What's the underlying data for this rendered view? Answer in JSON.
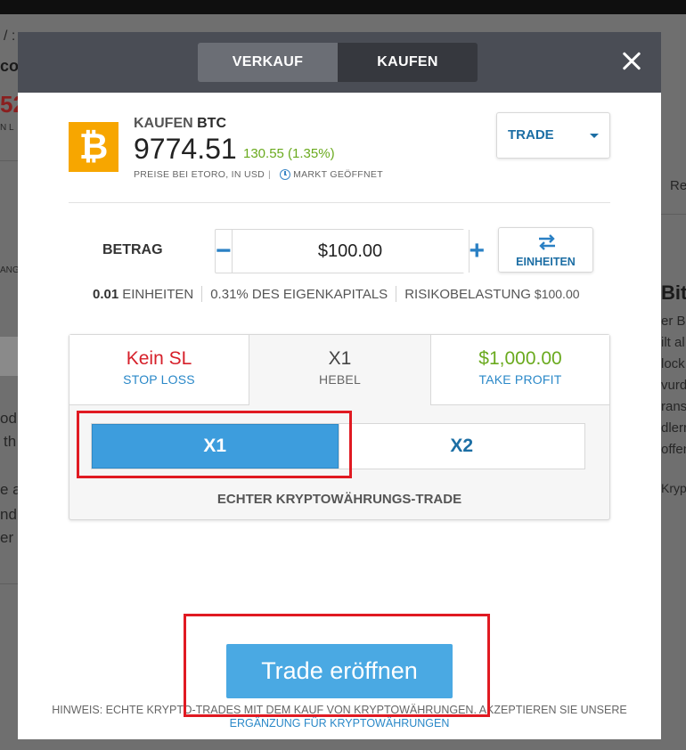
{
  "background": {
    "breadcrumb": "/ :",
    "fragments": [
      "coi",
      "52",
      "N L",
      "Re",
      "ANG",
      "Bitc",
      "er B",
      "ilt al",
      "lock",
      "vurd",
      "rans",
      "dlerr",
      "offen",
      "Kryp",
      "od",
      "th",
      "e a",
      "ndi",
      "er t"
    ]
  },
  "modal": {
    "tabs": {
      "sell": "VERKAUF",
      "buy": "KAUFEN"
    },
    "instrument": {
      "action": "KAUFEN",
      "symbol": "BTC",
      "logo_glyph": "₿",
      "price": "9774.51",
      "change": "130.55 (1.35%)",
      "price_note": "PREISE BEI ETORO, IN USD",
      "market_status": "MARKT GEÖFFNET"
    },
    "order_type": "TRADE",
    "amount": {
      "label": "BETRAG",
      "value": "$100.00",
      "minus": "−",
      "plus": "+",
      "units_button": "EINHEITEN"
    },
    "info": {
      "units_value": "0.01",
      "units_label": "EINHEITEN",
      "equity": "0.31% DES EIGENKAPITALS",
      "risk_label": "RISIKOBELASTUNG",
      "risk_value": "$100.00"
    },
    "panel": {
      "stop_loss": {
        "value": "Kein SL",
        "label": "STOP LOSS"
      },
      "leverage": {
        "value": "X1",
        "label": "HEBEL"
      },
      "take_profit": {
        "value": "$1,000.00",
        "label": "TAKE PROFIT"
      },
      "options": [
        "X1",
        "X2"
      ],
      "selected": "X1",
      "note": "ECHTER KRYPTOWÄHRUNGS-TRADE"
    },
    "open_trade_button": "Trade eröffnen",
    "footer": {
      "notice": "HINWEIS: ECHTE KRYPTO-TRADES MIT DEM KAUF VON KRYPTOWÄHRUNGEN. AKZEPTIEREN SIE UNSERE",
      "link": "ERGÄNZUNG FÜR KRYPTOWÄHRUNGEN"
    }
  },
  "colors": {
    "header": "#4a4d55",
    "accent_blue": "#3d9ddd",
    "positive": "#6aaa1e",
    "negative": "#d6202a",
    "bitcoin": "#f7a600",
    "highlight": "#e01a22"
  }
}
